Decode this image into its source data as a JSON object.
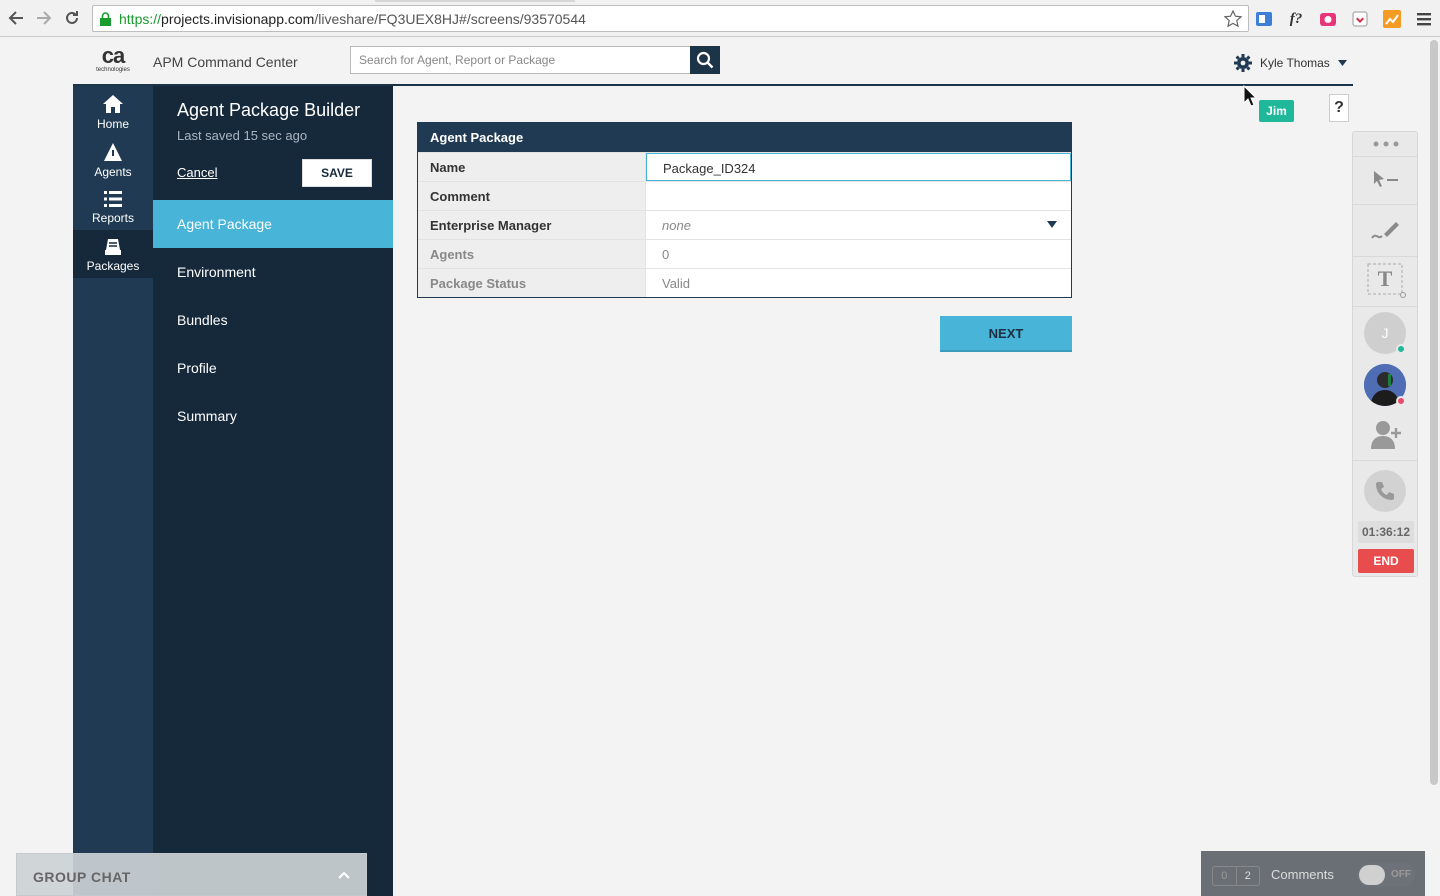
{
  "browser": {
    "url_scheme": "https://",
    "url_host": "projects.invisionapp.com",
    "url_path": "/liveshare/FQ3UEX8HJ#/screens/93570544"
  },
  "header": {
    "logo_text": "ca",
    "logo_subtext": "technologies",
    "app_title": "APM Command Center",
    "search_placeholder": "Search for Agent, Report or Package",
    "user_name": "Kyle Thomas"
  },
  "leftnav": {
    "items": [
      {
        "label": "Home",
        "icon": "home-icon"
      },
      {
        "label": "Agents",
        "icon": "agents-icon"
      },
      {
        "label": "Reports",
        "icon": "reports-icon"
      },
      {
        "label": "Packages",
        "icon": "packages-icon",
        "active": true
      }
    ]
  },
  "builder": {
    "title": "Agent Package Builder",
    "last_saved": "Last saved 15 sec ago",
    "cancel_label": "Cancel",
    "save_label": "SAVE",
    "steps": [
      {
        "label": "Agent Package",
        "active": true
      },
      {
        "label": "Environment"
      },
      {
        "label": "Bundles"
      },
      {
        "label": "Profile"
      },
      {
        "label": "Summary"
      }
    ]
  },
  "form": {
    "header": "Agent Package",
    "fields": [
      {
        "label": "Name",
        "value": "Package_ID324"
      },
      {
        "label": "Comment",
        "value": ""
      },
      {
        "label": "Enterprise Manager",
        "value": "none"
      },
      {
        "label": "Agents",
        "value": "0"
      },
      {
        "label": "Package Status",
        "value": "Valid"
      }
    ],
    "next_label": "NEXT"
  },
  "liveshare": {
    "help_label": "?",
    "pointer_user": "Jim",
    "avatar_initial": "J",
    "timer": "01:36:12",
    "end_label": "END"
  },
  "group_chat": {
    "label": "GROUP CHAT"
  },
  "comments": {
    "count_a": "0",
    "count_b": "2",
    "label": "Comments",
    "toggle": "OFF"
  },
  "colors": {
    "navy": "#1f3a52",
    "navy_dark": "#16293b",
    "accent": "#47b4d8",
    "jim_teal": "#1fb89b",
    "end_red": "#e84c4c"
  }
}
